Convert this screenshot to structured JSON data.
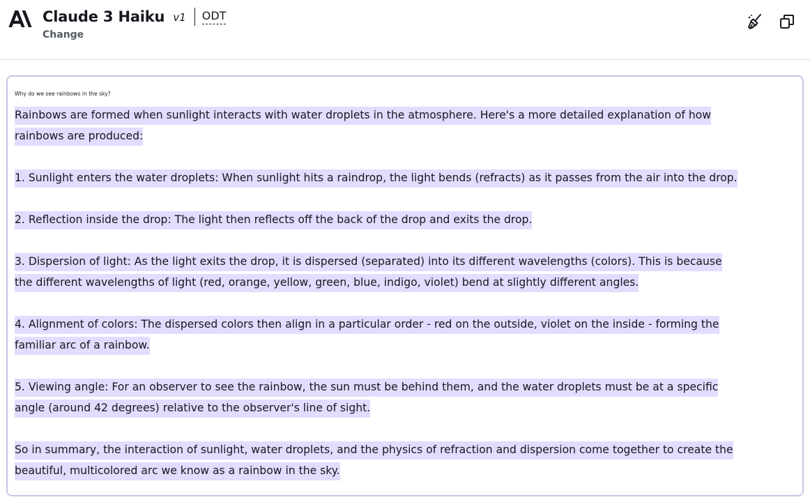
{
  "header": {
    "model_name": "Claude 3 Haiku",
    "model_version": "v1",
    "throughput": "ODT",
    "change_label": "Change",
    "icons": {
      "logo": "anthropic-logo",
      "clear": "broom-icon",
      "copy": "copy-icon"
    }
  },
  "chat": {
    "prompt": "Why do we see rainbows in the sky?",
    "response_lines": [
      "Rainbows are formed when sunlight interacts with water droplets in the atmosphere. Here's a more detailed explanation of how",
      "rainbows are produced:",
      "",
      "1. Sunlight enters the water droplets: When sunlight hits a raindrop, the light bends (refracts) as it passes from the air into the drop.",
      "",
      "2. Reflection inside the drop: The light then reflects off the back of the drop and exits the drop.",
      "",
      "3. Dispersion of light: As the light exits the drop, it is dispersed (separated) into its different wavelengths (colors). This is because",
      "the different wavelengths of light (red, orange, yellow, green, blue, indigo, violet) bend at slightly different angles.",
      "",
      "4. Alignment of colors: The dispersed colors then align in a particular order - red on the outside, violet on the inside - forming the",
      "familiar arc of a rainbow.",
      "",
      "5. Viewing angle: For an observer to see the rainbow, the sun must be behind them, and the water droplets must be at a specific",
      "angle (around 42 degrees) relative to the observer's line of sight.",
      "",
      "So in summary, the interaction of sunlight, water droplets, and the physics of refraction and dispersion come together to create the",
      "beautiful, multicolored arc we know as a rainbow in the sky."
    ]
  },
  "colors": {
    "highlight": "#e2dcff",
    "panel_border": "#c9c4e6",
    "text": "#16191f",
    "muted": "#545b64"
  }
}
